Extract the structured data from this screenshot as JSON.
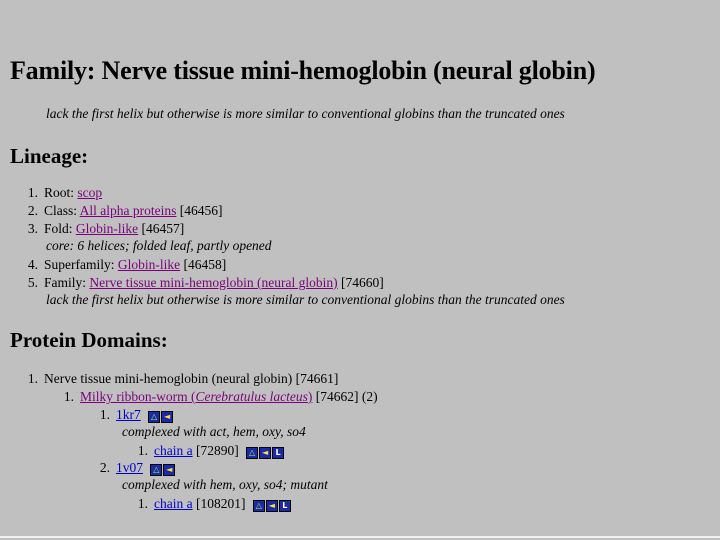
{
  "family": {
    "heading": "Family: Nerve tissue mini-hemoglobin (neural globin)",
    "description": "lack the first helix but otherwise is more similar to conventional globins than the truncated ones"
  },
  "lineage": {
    "heading": "Lineage:",
    "items": [
      {
        "num": "1.",
        "label": "Root:",
        "link": "scop",
        "id": ""
      },
      {
        "num": "2.",
        "label": "Class:",
        "link": "All alpha proteins",
        "id": "[46456]"
      },
      {
        "num": "3.",
        "label": "Fold:",
        "link": "Globin-like",
        "id": "[46457]",
        "note": "core: 6 helices; folded leaf, partly opened"
      },
      {
        "num": "4.",
        "label": "Superfamily:",
        "link": "Globin-like",
        "id": "[46458]"
      },
      {
        "num": "5.",
        "label": "Family:",
        "link": "Nerve tissue mini-hemoglobin (neural globin)",
        "id": "[74660]",
        "note": "lack the first helix but otherwise is more similar to conventional globins than the truncated ones"
      }
    ]
  },
  "domains": {
    "heading": "Protein Domains:",
    "protein": {
      "num": "1.",
      "text": "Nerve tissue mini-hemoglobin (neural globin) [74661]"
    },
    "species": {
      "num": "1.",
      "link_plain": "Milky ribbon-worm (",
      "link_italic": "Cerebratulus lacteus",
      "link_close": ")",
      "id": "[74662] (2)"
    },
    "entries": [
      {
        "num": "1.",
        "pdb": "1kr7",
        "note": "complexed with act, hem, oxy, so4",
        "chain_num": "1.",
        "chain": "chain a",
        "chain_id": "[72890]"
      },
      {
        "num": "2.",
        "pdb": "1v07",
        "note": "complexed with hem, oxy, so4; mutant",
        "chain_num": "1.",
        "chain": "chain a",
        "chain_id": "[108201]"
      }
    ]
  },
  "icons": {
    "mol": "molecule-icon",
    "arrow": "arrow-icon",
    "label": "L"
  }
}
